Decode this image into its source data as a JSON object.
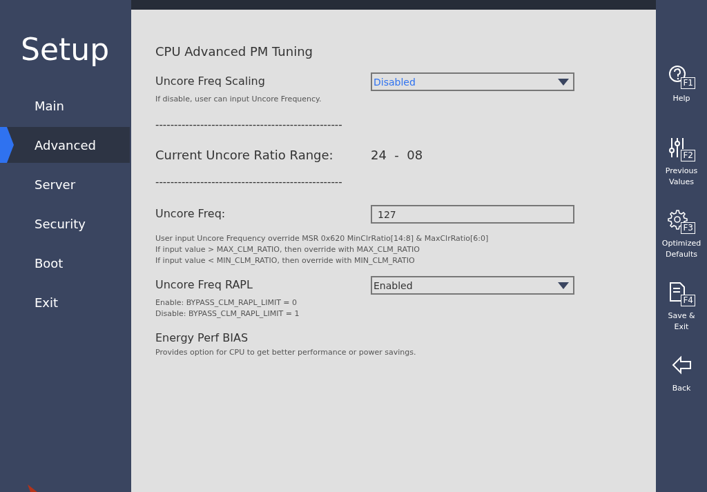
{
  "sidebar": {
    "title": "Setup",
    "items": [
      {
        "label": "Main",
        "selected": false
      },
      {
        "label": "Advanced",
        "selected": true
      },
      {
        "label": "Server",
        "selected": false
      },
      {
        "label": "Security",
        "selected": false
      },
      {
        "label": "Boot",
        "selected": false
      },
      {
        "label": "Exit",
        "selected": false
      }
    ]
  },
  "content": {
    "title": "CPU Advanced PM Tuning",
    "items": [
      {
        "kind": "dropdown",
        "label": "Uncore Freq Scaling",
        "value": "Disabled",
        "focused": true,
        "help": [
          "If disable, user can input Uncore Frequency."
        ]
      },
      {
        "kind": "divider",
        "text": "--------------------------------------------------"
      },
      {
        "kind": "range",
        "label": "Current Uncore Ratio Range:",
        "value": "24  -  08"
      },
      {
        "kind": "divider",
        "text": "--------------------------------------------------"
      },
      {
        "kind": "input",
        "label": "Uncore Freq:",
        "value": "127",
        "help": [
          "User input Uncore Frequency override MSR 0x620 MinClrRatio[14:8] & MaxClrRatio[6:0]",
          "If input value > MAX_CLM_RATIO, then override with MAX_CLM_RATIO",
          "If input value < MIN_CLM_RATIO, then override with MIN_CLM_RATIO"
        ]
      },
      {
        "kind": "dropdown",
        "label": "Uncore Freq RAPL",
        "value": "Enabled",
        "focused": false,
        "help": [
          "Enable: BYPASS_CLM_RAPL_LIMIT = 0",
          "Disable: BYPASS_CLM_RAPL_LIMIT = 1"
        ]
      },
      {
        "kind": "heading",
        "label": "Energy Perf BIAS",
        "help": [
          "Provides option for CPU to get better performance or power savings."
        ]
      }
    ]
  },
  "actions": [
    {
      "kind": "help",
      "key": "F1",
      "label": "Help"
    },
    {
      "kind": "previous",
      "key": "F2",
      "label": "Previous Values"
    },
    {
      "kind": "defaults",
      "key": "F3",
      "label": "Optimized Defaults"
    },
    {
      "kind": "save",
      "key": "F4",
      "label": "Save & Exit"
    },
    {
      "kind": "back",
      "label": "Back"
    }
  ]
}
